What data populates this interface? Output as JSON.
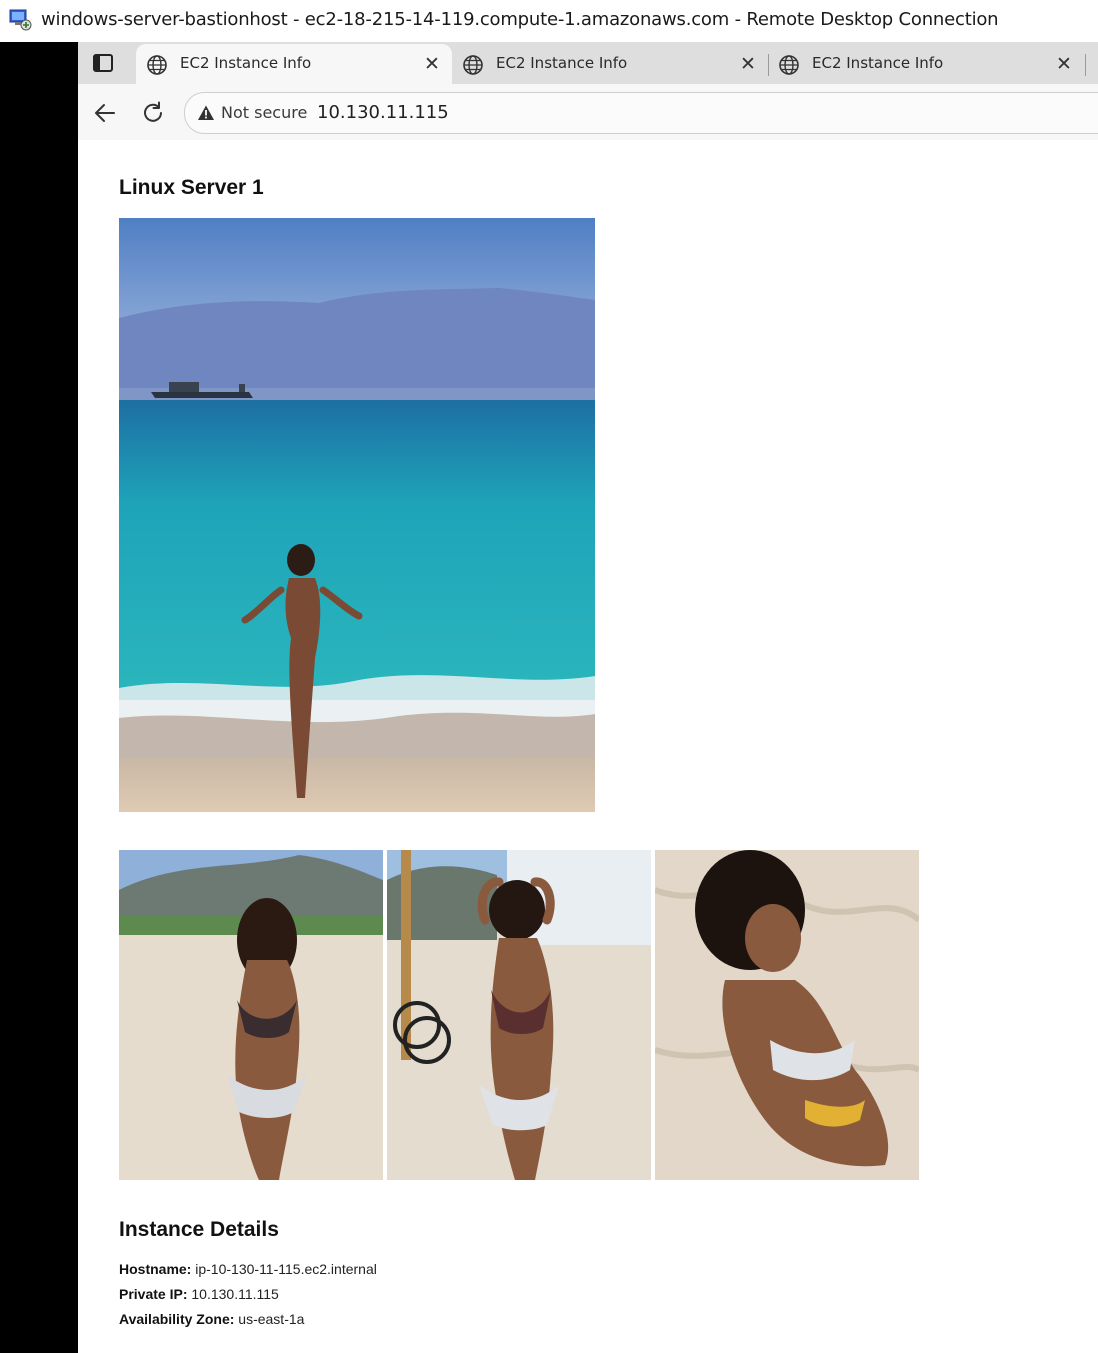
{
  "window": {
    "title": "windows-server-bastionhost - ec2-18-215-14-119.compute-1.amazonaws.com - Remote Desktop Connection"
  },
  "browser": {
    "tabs": [
      {
        "label": "EC2 Instance Info",
        "active": true
      },
      {
        "label": "EC2 Instance Info",
        "active": false
      },
      {
        "label": "EC2 Instance Info",
        "active": false
      }
    ],
    "close_glyph": "✕",
    "security_label": "Not secure",
    "url": "10.130.11.115"
  },
  "page": {
    "title": "Linux Server 1",
    "details_title": "Instance Details",
    "details": [
      {
        "label": "Hostname:",
        "value": "ip-10-130-11-115.ec2.internal"
      },
      {
        "label": "Private IP:",
        "value": "10.130.11.115"
      },
      {
        "label": "Availability Zone:",
        "value": "us-east-1a"
      }
    ]
  },
  "colors": {
    "tabstrip_bg": "#dedede",
    "toolbar_bg": "#f7f7f7",
    "sky": "#5b86c8",
    "sea": "#22a6b8",
    "sand": "#e6dccd"
  }
}
